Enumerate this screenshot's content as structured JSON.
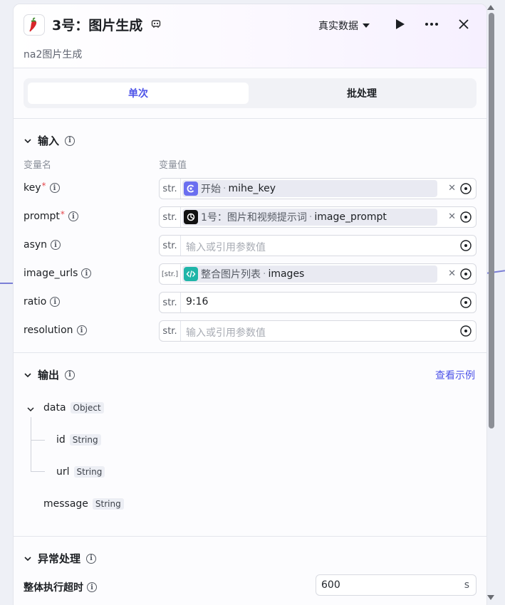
{
  "header": {
    "title": "3号：图片生成",
    "subtitle": "na2图片生成",
    "mode_label": "真实数据",
    "node_icon": "chili-pepper-icon",
    "title_icon": "robot-icon"
  },
  "tabs": [
    {
      "label": "单次",
      "active": true
    },
    {
      "label": "批处理",
      "active": false
    }
  ],
  "input": {
    "title": "输入",
    "col_name": "变量名",
    "col_value": "变量值",
    "rows": [
      {
        "name": "key",
        "required": true,
        "type": "str.",
        "ref_source": "开始",
        "ref_var": "mihe_key"
      },
      {
        "name": "prompt",
        "required": true,
        "type": "str.",
        "ref_source": "1号：图片和视频提示词",
        "ref_var": "image_prompt"
      },
      {
        "name": "asyn",
        "required": false,
        "type": "str.",
        "placeholder": "输入或引用参数值"
      },
      {
        "name": "image_urls",
        "required": false,
        "type": "[str.]",
        "ref_source": "整合图片列表",
        "ref_var": "images"
      },
      {
        "name": "ratio",
        "required": false,
        "type": "str.",
        "value": "9:16"
      },
      {
        "name": "resolution",
        "required": false,
        "type": "str.",
        "placeholder": "输入或引用参数值"
      }
    ]
  },
  "output": {
    "title": "输出",
    "example_link": "查看示例",
    "tree": [
      {
        "name": "data",
        "type": "Object"
      },
      {
        "name": "id",
        "type": "String"
      },
      {
        "name": "url",
        "type": "String"
      },
      {
        "name": "message",
        "type": "String"
      }
    ]
  },
  "exception": {
    "title": "异常处理",
    "timeout_label": "整体执行超时",
    "timeout_value": "600",
    "timeout_unit": "s"
  },
  "colors": {
    "accent": "#4d53e8",
    "required": "#e5484d",
    "start_icon_bg": "#6b6ff0",
    "list_icon_bg": "#1fb5a8"
  }
}
